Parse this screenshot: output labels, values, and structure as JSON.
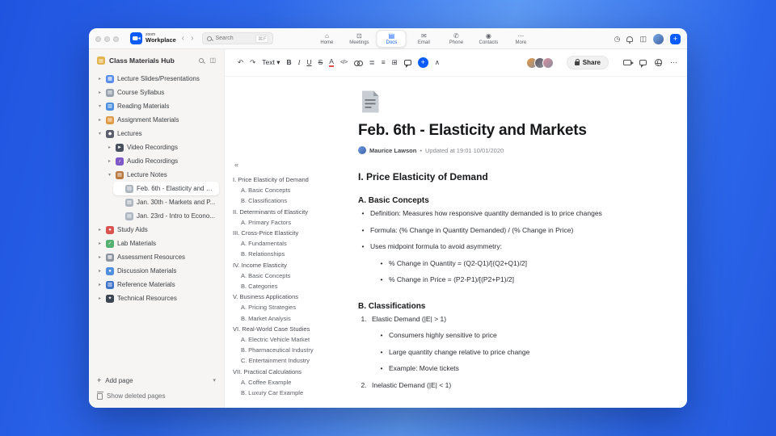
{
  "colors": {
    "accent": "#0b5cff",
    "selected_item_bg": "#ffffff",
    "sidebar_bg": "#f6f5f3"
  },
  "titlebar": {
    "brand_top": "zoom",
    "brand_bottom": "Workplace",
    "back": "‹",
    "forward": "›",
    "search": {
      "placeholder": "Search",
      "shortcut": "⌘F"
    },
    "tabs": [
      {
        "label": "Home",
        "icon": "home-icon",
        "glyph": "⌂",
        "active": false
      },
      {
        "label": "Meetings",
        "icon": "meetings-icon",
        "glyph": "⊡",
        "active": false
      },
      {
        "label": "Docs",
        "icon": "docs-icon",
        "glyph": "▤",
        "active": true
      },
      {
        "label": "Email",
        "icon": "email-icon",
        "glyph": "✉",
        "active": false
      },
      {
        "label": "Phone",
        "icon": "phone-icon",
        "glyph": "✆",
        "active": false
      },
      {
        "label": "Contacts",
        "icon": "contacts-icon",
        "glyph": "◉",
        "active": false
      },
      {
        "label": "More",
        "icon": "more-icon",
        "glyph": "⋯",
        "active": false
      }
    ],
    "right_icons": [
      {
        "name": "recent-icon",
        "glyph": "◷"
      },
      {
        "name": "notifications-icon",
        "glyph": ""
      },
      {
        "name": "panel-icon",
        "glyph": "◫"
      },
      {
        "name": "profile-avatar",
        "glyph": ""
      },
      {
        "name": "new-button",
        "glyph": "+"
      }
    ]
  },
  "sidebar": {
    "title": "Class Materials Hub",
    "add_page": "Add page",
    "show_deleted": "Show deleted pages",
    "items": [
      {
        "label": "Lecture Slides/Presentations",
        "depth": 0,
        "chevron": "right",
        "icon_name": "presentation-icon",
        "icon_color": "#5b8def",
        "icon_glyph": "▦"
      },
      {
        "label": "Course Syllabus",
        "depth": 0,
        "chevron": "right",
        "icon_name": "syllabus-icon",
        "icon_color": "#98a1ac",
        "icon_glyph": "▤"
      },
      {
        "label": "Reading Materials",
        "depth": 0,
        "chevron": "down",
        "icon_name": "reading-icon",
        "icon_color": "#4f8fe0",
        "icon_glyph": "▥"
      },
      {
        "label": "Assignment Materials",
        "depth": 0,
        "chevron": "right",
        "icon_name": "assignment-icon",
        "icon_color": "#e09a43",
        "icon_glyph": "▤"
      },
      {
        "label": "Lectures",
        "depth": 0,
        "chevron": "down",
        "icon_name": "lectures-icon",
        "icon_color": "#5a5f6b",
        "icon_glyph": "◆"
      },
      {
        "label": "Video Recordings",
        "depth": 1,
        "chevron": "right",
        "icon_name": "video-recordings-icon",
        "icon_color": "#47505c",
        "icon_glyph": "►"
      },
      {
        "label": "Audio Recordings",
        "depth": 1,
        "chevron": "right",
        "icon_name": "audio-recordings-icon",
        "icon_color": "#8059c8",
        "icon_glyph": "♪"
      },
      {
        "label": "Lecture Notes",
        "depth": 1,
        "chevron": "down",
        "icon_name": "lecture-notes-icon",
        "icon_color": "#b9793f",
        "icon_glyph": "▤"
      },
      {
        "label": "Feb. 6th - Elasticity and M...",
        "depth": 2,
        "chevron": null,
        "icon_name": "page-icon",
        "icon_color": "#aeb6c0",
        "icon_glyph": "▤",
        "selected": true
      },
      {
        "label": "Jan. 30th - Markets and P...",
        "depth": 2,
        "chevron": null,
        "icon_name": "page-icon",
        "icon_color": "#aeb6c0",
        "icon_glyph": "▤"
      },
      {
        "label": "Jan. 23rd - Intro to Econo...",
        "depth": 2,
        "chevron": null,
        "icon_name": "page-icon",
        "icon_color": "#aeb6c0",
        "icon_glyph": "▤"
      },
      {
        "label": "Study Aids",
        "depth": 0,
        "chevron": "right",
        "icon_name": "study-aids-icon",
        "icon_color": "#d9534f",
        "icon_glyph": "●"
      },
      {
        "label": "Lab Materials",
        "depth": 0,
        "chevron": "right",
        "icon_name": "lab-materials-icon",
        "icon_color": "#53b06e",
        "icon_glyph": "✓"
      },
      {
        "label": "Assessment Resources",
        "depth": 0,
        "chevron": "right",
        "icon_name": "assessment-icon",
        "icon_color": "#8d96a0",
        "icon_glyph": "▦"
      },
      {
        "label": "Discussion Materials",
        "depth": 0,
        "chevron": "right",
        "icon_name": "discussion-icon",
        "icon_color": "#4f8fe0",
        "icon_glyph": "●"
      },
      {
        "label": "Reference Materials",
        "depth": 0,
        "chevron": "right",
        "icon_name": "reference-icon",
        "icon_color": "#3f74c9",
        "icon_glyph": "▥"
      },
      {
        "label": "Technical Resources",
        "depth": 0,
        "chevron": "right",
        "icon_name": "technical-icon",
        "icon_color": "#3c4652",
        "icon_glyph": "✦"
      }
    ]
  },
  "doc_toolbar": {
    "share_label": "Share",
    "buttons": [
      {
        "name": "undo-icon",
        "glyph": "↶"
      },
      {
        "name": "redo-icon",
        "glyph": "↷"
      },
      {
        "name": "text-style-dropdown",
        "glyph": "Text ▾"
      },
      {
        "name": "bold-icon",
        "glyph": "B"
      },
      {
        "name": "italic-icon",
        "glyph": "I"
      },
      {
        "name": "underline-icon",
        "glyph": "U"
      },
      {
        "name": "strikethrough-icon",
        "glyph": "S"
      },
      {
        "name": "text-color-icon",
        "glyph": "A"
      },
      {
        "name": "code-icon",
        "glyph": "</>"
      },
      {
        "name": "link-icon",
        "glyph": ""
      },
      {
        "name": "list-icon",
        "glyph": "≣"
      },
      {
        "name": "align-icon",
        "glyph": "≡"
      },
      {
        "name": "table-icon",
        "glyph": "⊞"
      },
      {
        "name": "comment-icon",
        "glyph": ""
      },
      {
        "name": "insert-icon",
        "glyph": "+"
      },
      {
        "name": "collapse-toolbar-icon",
        "glyph": "∧"
      }
    ],
    "collaborators": [
      "#e8973f",
      "#5b5560",
      "#d98ca0"
    ],
    "right_icons": [
      {
        "name": "video-icon",
        "glyph": ""
      },
      {
        "name": "chat-icon",
        "glyph": ""
      },
      {
        "name": "language-icon",
        "glyph": ""
      },
      {
        "name": "more-icon",
        "glyph": "⋯"
      }
    ]
  },
  "outline": {
    "collapse_icon": "«",
    "items": [
      {
        "text": "I. Price Elasticity of Demand",
        "level": 0
      },
      {
        "text": "A. Basic Concepts",
        "level": 1
      },
      {
        "text": "B. Classifications",
        "level": 1
      },
      {
        "text": "II. Determinants of Elasticity",
        "level": 0
      },
      {
        "text": "A. Primary Factors",
        "level": 1
      },
      {
        "text": "III. Cross-Price Elasticity",
        "level": 0
      },
      {
        "text": "A. Fundamentals",
        "level": 1
      },
      {
        "text": "B. Relationships",
        "level": 1
      },
      {
        "text": "IV. Income Elasticity",
        "level": 0
      },
      {
        "text": "A. Basic Concepts",
        "level": 1
      },
      {
        "text": "B. Categories",
        "level": 1
      },
      {
        "text": "V. Business Applications",
        "level": 0
      },
      {
        "text": "A. Pricing Strategies",
        "level": 1
      },
      {
        "text": "B. Market Analysis",
        "level": 1
      },
      {
        "text": "VI. Real-World Case Studies",
        "level": 0
      },
      {
        "text": "A. Electric Vehicle Market",
        "level": 1
      },
      {
        "text": "B. Pharmaceutical Industry",
        "level": 1
      },
      {
        "text": "C. Entertainment Industry",
        "level": 1
      },
      {
        "text": "VII. Practical Calculations",
        "level": 0
      },
      {
        "text": "A. Coffee Example",
        "level": 1
      },
      {
        "text": "B. Luxury Car Example",
        "level": 1
      }
    ]
  },
  "doc": {
    "title": "Feb. 6th - Elasticity and Markets",
    "author": "Maurice Lawson",
    "meta_separator": "•",
    "updated": "Updated at 19:01 10/01/2020",
    "blocks": [
      {
        "type": "h2",
        "text": "I. Price Elasticity of Demand"
      },
      {
        "type": "h3",
        "text": "A. Basic Concepts"
      },
      {
        "type": "bullet",
        "level": 1,
        "text": "Definition: Measures how responsive quantity demanded is to price changes"
      },
      {
        "type": "bullet",
        "level": 1,
        "text": "Formula: (% Change in Quantity Demanded) / (% Change in Price)"
      },
      {
        "type": "bullet",
        "level": 1,
        "text": "Uses midpoint formula to avoid asymmetry:"
      },
      {
        "type": "bullet",
        "level": 2,
        "text": "% Change in Quantity = (Q2-Q1)/[(Q2+Q1)/2]"
      },
      {
        "type": "bullet",
        "level": 2,
        "text": "% Change in Price = (P2-P1)/[(P2+P1)/2]"
      },
      {
        "type": "h3",
        "text": "B. Classifications"
      },
      {
        "type": "num",
        "n": "1.",
        "level": 1,
        "text": "Elastic Demand (|E| > 1)"
      },
      {
        "type": "bullet",
        "level": 2,
        "text": "Consumers highly sensitive to price"
      },
      {
        "type": "bullet",
        "level": 2,
        "text": "Large quantity change relative to price change"
      },
      {
        "type": "bullet",
        "level": 2,
        "text": "Example: Movie tickets"
      },
      {
        "type": "num",
        "n": "2.",
        "level": 1,
        "text": "Inelastic Demand (|E| < 1)"
      }
    ]
  }
}
